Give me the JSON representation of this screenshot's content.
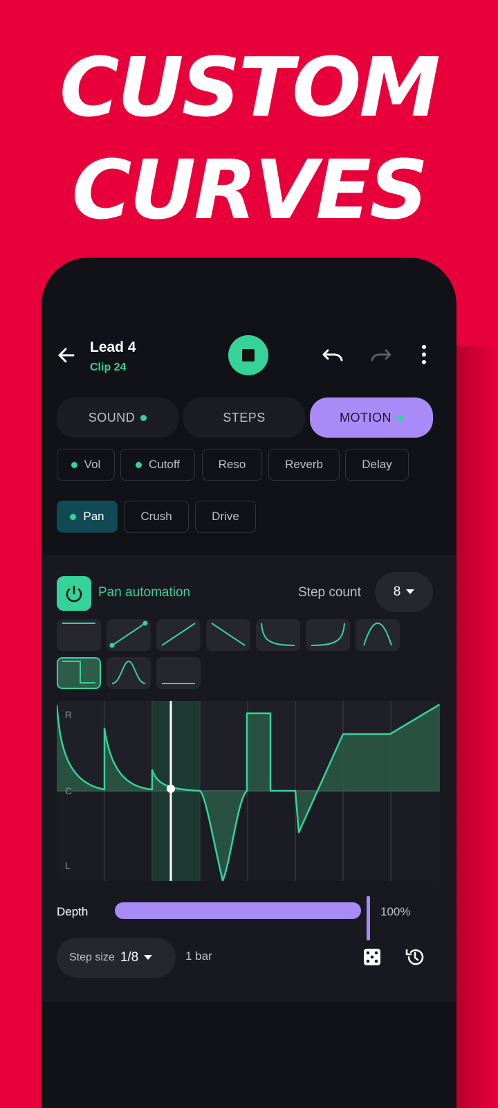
{
  "promo": {
    "line1": "CUSTOM",
    "line2": "CURVES"
  },
  "header": {
    "title": "Lead 4",
    "subtitle": "Clip 24"
  },
  "tabs": [
    {
      "label": "SOUND",
      "dot": true
    },
    {
      "label": "STEPS",
      "dot": false
    },
    {
      "label": "MOTION",
      "dot": true,
      "active": true
    }
  ],
  "params": [
    {
      "label": "Vol",
      "dot": true
    },
    {
      "label": "Cutoff",
      "dot": true
    },
    {
      "label": "Reso",
      "dot": false
    },
    {
      "label": "Reverb",
      "dot": false
    },
    {
      "label": "Delay",
      "dot": false
    },
    {
      "label": "Pan",
      "dot": true,
      "active": true
    },
    {
      "label": "Crush",
      "dot": false
    },
    {
      "label": "Drive",
      "dot": false
    }
  ],
  "automation": {
    "label": "Pan automation",
    "enabled": true
  },
  "step_count": {
    "label": "Step count",
    "value": "8"
  },
  "shapes": [
    "flat-high",
    "ramp-up-points",
    "ramp-up",
    "ramp-down",
    "exp-decay",
    "exp-rise",
    "bell",
    "square-pulse",
    "gaussian",
    "flat-low"
  ],
  "graph": {
    "labels": {
      "top": "R",
      "mid": "C",
      "bottom": "L"
    },
    "playhead_step": 2
  },
  "depth": {
    "label": "Depth",
    "value": "100%",
    "fraction": 1.0
  },
  "step_size": {
    "label": "Step size",
    "value": "1/8"
  },
  "length": {
    "value": "1 bar"
  },
  "colors": {
    "accent": "#35D39A",
    "purple": "#A98BF7",
    "brand_red": "#E8003A"
  }
}
